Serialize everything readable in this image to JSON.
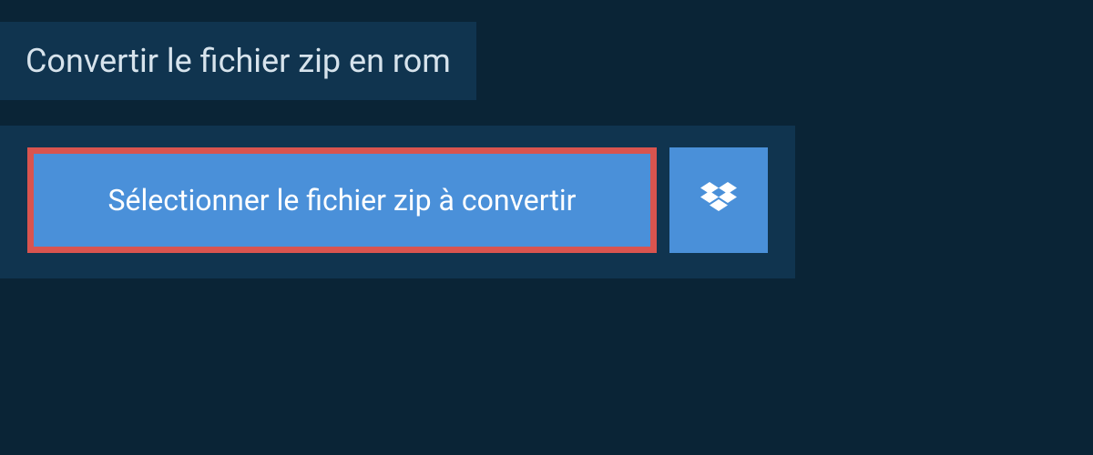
{
  "header": {
    "title": "Convertir le fichier zip en rom"
  },
  "actions": {
    "select_file_label": "Sélectionner le fichier zip à convertir"
  }
}
